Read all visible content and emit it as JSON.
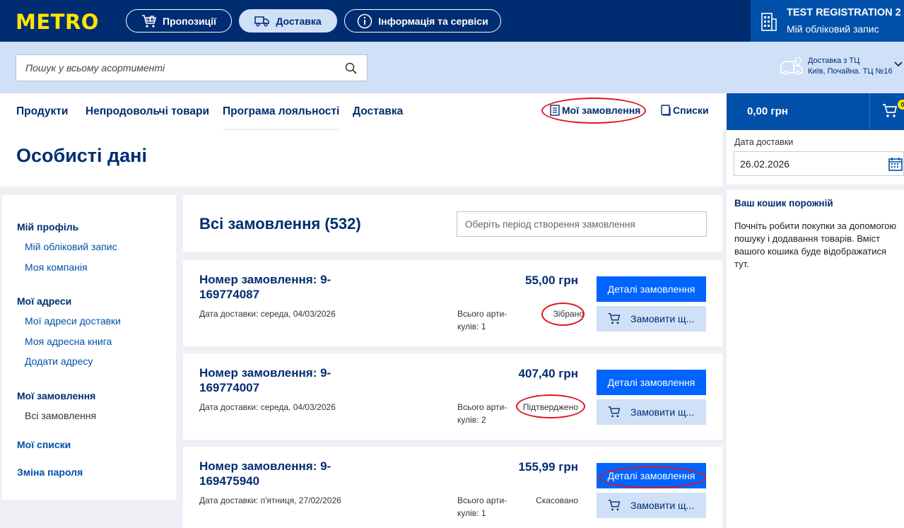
{
  "header": {
    "logo": "METRO",
    "pills": [
      {
        "label": "Пропозиції",
        "icon": "trolley-icon",
        "active": false
      },
      {
        "label": "Доставка",
        "icon": "truck-icon",
        "active": true
      },
      {
        "label": "Інформація та сервіси",
        "icon": "info-icon",
        "active": false
      }
    ],
    "account": {
      "name": "TEST REGISTRATION 2",
      "link": "Мій обліковий запис",
      "icon": "building-icon"
    }
  },
  "search": {
    "placeholder": "Пошук у всьому асортименті",
    "icon": "search-icon"
  },
  "delivery": {
    "line1": "Доставка з ТЦ",
    "line2": "Київ, Почайна. ТЦ №16",
    "icon": "delivery-car-icon"
  },
  "nav": {
    "items": [
      "Продукти",
      "Непродовольчі товари",
      "Програма лояльності",
      "Доставка"
    ],
    "my_orders": "Мої замовлення",
    "lists": "Списки"
  },
  "cart": {
    "total": "0,00 грн",
    "badge": "0"
  },
  "page_title": "Особисті дані",
  "sidebar": {
    "delivery_date_label": "Дата доставки",
    "delivery_date": "26.02.2026",
    "empty_title": "Ваш кошик порожній",
    "empty_text": "Почніть робити покупки за допомогою пошуку і додавання товарів. Вміст вашого кошика буде відображатися тут."
  },
  "leftnav": {
    "profile": "Мій профіль",
    "account": "Мій обліковий запис",
    "company": "Моя компанія",
    "addresses": "Мої адреси",
    "delivery_addresses": "Мої адреси доставки",
    "address_book": "Моя адресна книга",
    "add_address": "Додати адресу",
    "orders": "Мої замовлення",
    "all_orders": "Всі замовлення",
    "lists": "Мої списки",
    "change_password": "Зміна пароля"
  },
  "orders": {
    "title": "Всі замовлення (532)",
    "period_placeholder": "Оберіть період створення замовлення",
    "details_label": "Деталі замовлення",
    "reorder_label": "Замовити щ...",
    "list": [
      {
        "number": "Номер замовлення:  9-169774087",
        "date": "Дата доставки:  середа, 04/03/2026",
        "price": "55,00 грн",
        "items": "Всього арти-кулів: 1",
        "status": "Зібрано"
      },
      {
        "number": "Номер замовлення:  9-169774007",
        "date": "Дата доставки:  середа, 04/03/2026",
        "price": "407,40 грн",
        "items": "Всього арти-кулів: 2",
        "status": "Підтверджено"
      },
      {
        "number": "Номер замовлення:  9-169475940",
        "date": "Дата доставки:  п'ятниця, 27/02/2026",
        "price": "155,99 грн",
        "items": "Всього арти-кулів: 1",
        "status": "Скасовано"
      }
    ]
  }
}
